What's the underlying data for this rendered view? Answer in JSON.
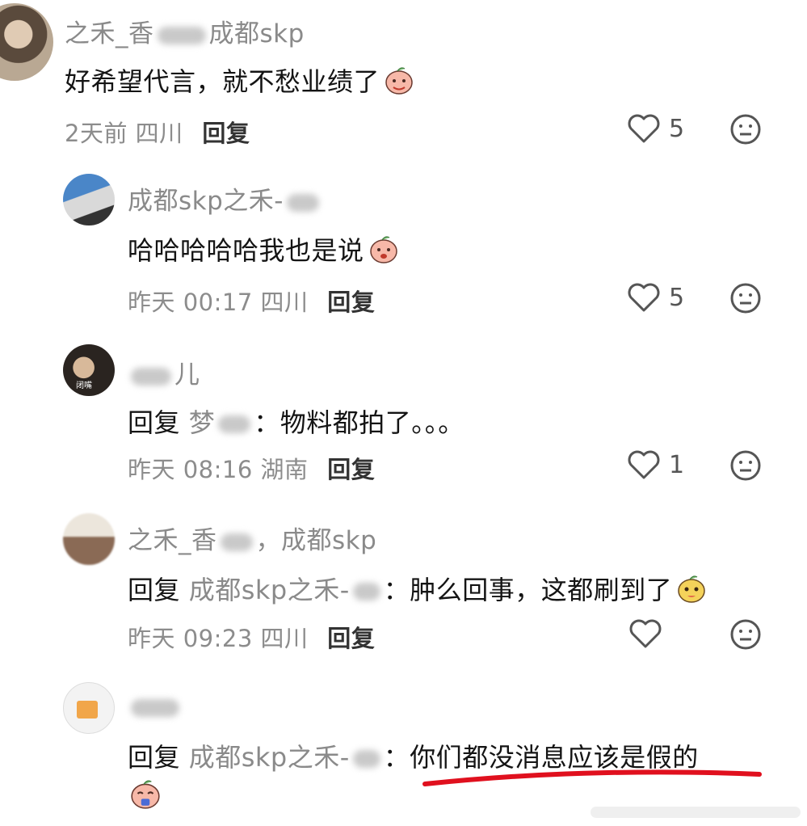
{
  "comments": [
    {
      "user": "之禾_香",
      "user_suffix": "成都skp",
      "text": "好希望代言，就不愁业绩了",
      "time": "2天前",
      "region": "四川",
      "reply_label": "回复",
      "likes": "5"
    },
    {
      "user": "成都skp之禾-",
      "user_suffix": "",
      "text": "哈哈哈哈哈我也是说",
      "time": "昨天 00:17",
      "region": "四川",
      "reply_label": "回复",
      "likes": "5"
    },
    {
      "user": "",
      "user_suffix": "儿",
      "reply_prefix": "回复",
      "reply_to": "梦",
      "text": "：物料都拍了。。。",
      "time": "昨天 08:16",
      "region": "湖南",
      "reply_label": "回复",
      "likes": "1",
      "avatar_caption": "闭嘴"
    },
    {
      "user": "之禾_香",
      "user_suffix": "，成都skp",
      "reply_prefix": "回复",
      "reply_to": "成都skp之禾-",
      "text": "：肿么回事，这都刷到了",
      "time": "昨天 09:23",
      "region": "四川",
      "reply_label": "回复",
      "likes": ""
    },
    {
      "user": "",
      "user_suffix": "",
      "reply_prefix": "回复",
      "reply_to": "成都skp之禾-",
      "text": "：你们都没消息应该是假的",
      "highlight_color": "#e0101e"
    }
  ],
  "icons": {
    "like": "heart-outline-icon",
    "dislike": "neutral-face-icon",
    "sticker": "peach-sticker-icon"
  }
}
